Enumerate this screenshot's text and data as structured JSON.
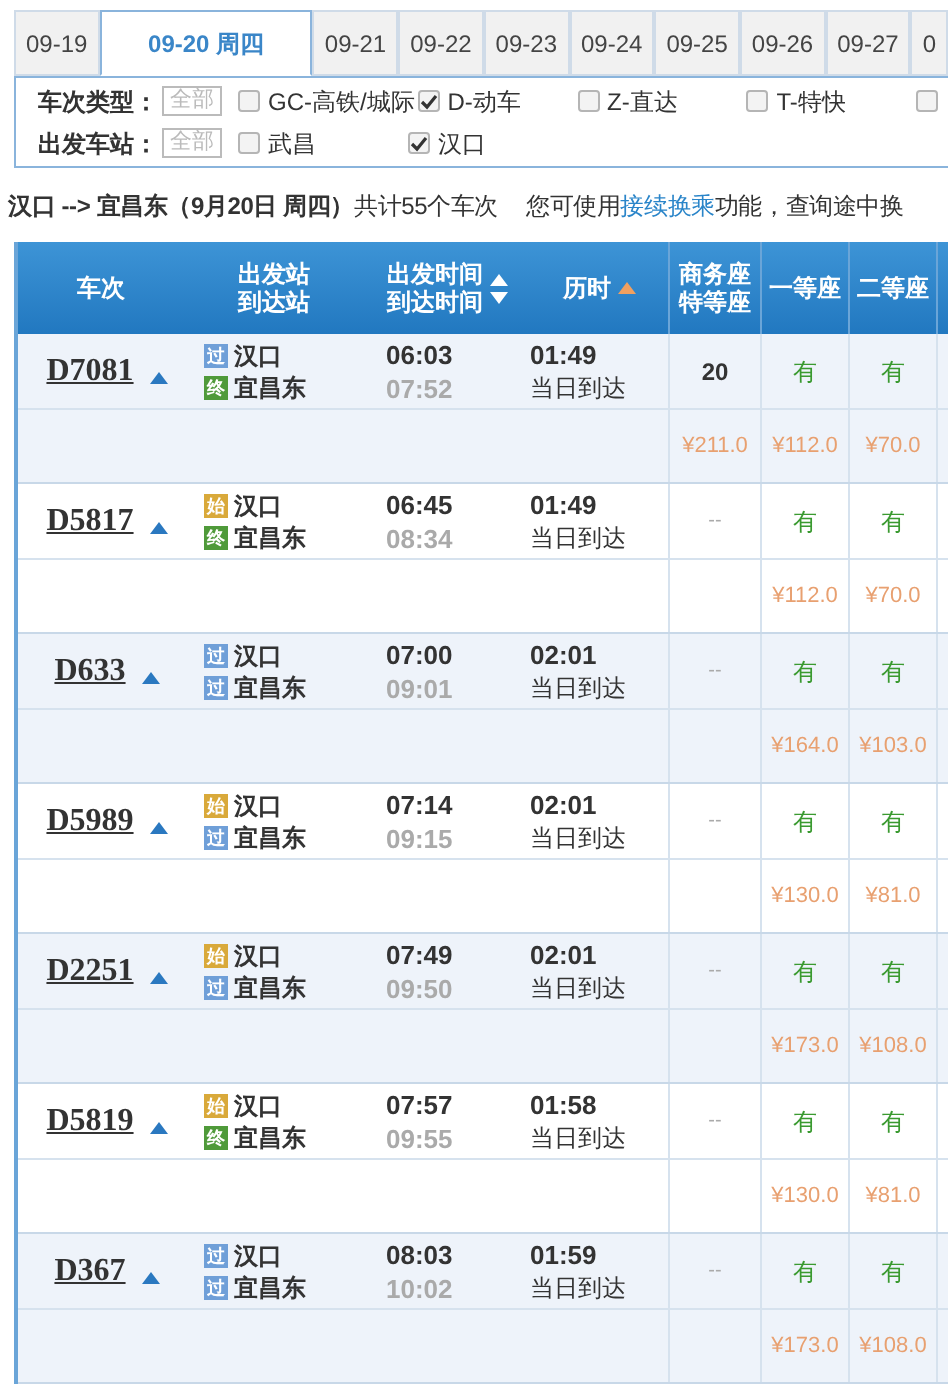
{
  "date_tabs": [
    {
      "label": "09-19",
      "selected": false
    },
    {
      "label": "09-20 周四",
      "selected": true
    },
    {
      "label": "09-21",
      "selected": false
    },
    {
      "label": "09-22",
      "selected": false
    },
    {
      "label": "09-23",
      "selected": false
    },
    {
      "label": "09-24",
      "selected": false
    },
    {
      "label": "09-25",
      "selected": false
    },
    {
      "label": "09-26",
      "selected": false
    },
    {
      "label": "09-27",
      "selected": false
    },
    {
      "label": "0",
      "selected": false
    }
  ],
  "filters": [
    {
      "label": "车次类型：",
      "all_button": "全部",
      "options": [
        {
          "label": "GC-高铁/城际",
          "checked": false
        },
        {
          "label": "D-动车",
          "checked": true
        },
        {
          "label": "Z-直达",
          "checked": false
        },
        {
          "label": "T-特快",
          "checked": false
        },
        {
          "checked": false
        }
      ]
    },
    {
      "label": "出发车站：",
      "all_button": "全部",
      "options": [
        {
          "label": "武昌",
          "checked": false
        },
        {
          "label": "汉口",
          "checked": true
        }
      ]
    }
  ],
  "summary": {
    "route": "汉口 --> 宜昌东（9月20日  周四）",
    "count": "共计55个车次",
    "hint_before": "您可使用",
    "hint_link": "接续换乘",
    "hint_after": "功能，查询途中换"
  },
  "table": {
    "columns": [
      {
        "lines": [
          "车次"
        ]
      },
      {
        "lines": [
          "出发站",
          "到达站"
        ]
      },
      {
        "lines": [
          "出发时间",
          "到达时间"
        ],
        "sort_up": true,
        "sort_down": true
      },
      {
        "lines": [
          "历时"
        ],
        "sort_up": true,
        "sort_down": false
      },
      {
        "lines": [
          "商务座",
          "特等座"
        ]
      },
      {
        "lines": [
          "一等座"
        ]
      },
      {
        "lines": [
          "二等座"
        ]
      }
    ],
    "trains": [
      {
        "number": "D7081",
        "from_badge": {
          "kind": "pass",
          "text": "过"
        },
        "from": "汉口",
        "to_badge": {
          "kind": "end",
          "text": "终"
        },
        "to": "宜昌东",
        "depart": "06:03",
        "arrive": "07:52",
        "duration": "01:49",
        "arrival_day": "当日到达",
        "business": "20",
        "first": "有",
        "second": "有",
        "business_price": "¥211.0",
        "first_price": "¥112.0",
        "second_price": "¥70.0"
      },
      {
        "number": "D5817",
        "from_badge": {
          "kind": "start",
          "text": "始"
        },
        "from": "汉口",
        "to_badge": {
          "kind": "end",
          "text": "终"
        },
        "to": "宜昌东",
        "depart": "06:45",
        "arrive": "08:34",
        "duration": "01:49",
        "arrival_day": "当日到达",
        "business": "--",
        "first": "有",
        "second": "有",
        "first_price": "¥112.0",
        "second_price": "¥70.0"
      },
      {
        "number": "D633",
        "from_badge": {
          "kind": "pass",
          "text": "过"
        },
        "from": "汉口",
        "to_badge": {
          "kind": "pass",
          "text": "过"
        },
        "to": "宜昌东",
        "depart": "07:00",
        "arrive": "09:01",
        "duration": "02:01",
        "arrival_day": "当日到达",
        "business": "--",
        "first": "有",
        "second": "有",
        "first_price": "¥164.0",
        "second_price": "¥103.0"
      },
      {
        "number": "D5989",
        "from_badge": {
          "kind": "start",
          "text": "始"
        },
        "from": "汉口",
        "to_badge": {
          "kind": "pass",
          "text": "过"
        },
        "to": "宜昌东",
        "depart": "07:14",
        "arrive": "09:15",
        "duration": "02:01",
        "arrival_day": "当日到达",
        "business": "--",
        "first": "有",
        "second": "有",
        "first_price": "¥130.0",
        "second_price": "¥81.0"
      },
      {
        "number": "D2251",
        "from_badge": {
          "kind": "start",
          "text": "始"
        },
        "from": "汉口",
        "to_badge": {
          "kind": "pass",
          "text": "过"
        },
        "to": "宜昌东",
        "depart": "07:49",
        "arrive": "09:50",
        "duration": "02:01",
        "arrival_day": "当日到达",
        "business": "--",
        "first": "有",
        "second": "有",
        "first_price": "¥173.0",
        "second_price": "¥108.0"
      },
      {
        "number": "D5819",
        "from_badge": {
          "kind": "start",
          "text": "始"
        },
        "from": "汉口",
        "to_badge": {
          "kind": "end",
          "text": "终"
        },
        "to": "宜昌东",
        "depart": "07:57",
        "arrive": "09:55",
        "duration": "01:58",
        "arrival_day": "当日到达",
        "business": "--",
        "first": "有",
        "second": "有",
        "first_price": "¥130.0",
        "second_price": "¥81.0"
      },
      {
        "number": "D367",
        "from_badge": {
          "kind": "pass",
          "text": "过"
        },
        "from": "汉口",
        "to_badge": {
          "kind": "pass",
          "text": "过"
        },
        "to": "宜昌东",
        "depart": "08:03",
        "arrive": "10:02",
        "duration": "01:59",
        "arrival_day": "当日到达",
        "business": "--",
        "first": "有",
        "second": "有",
        "first_price": "¥173.0",
        "second_price": "¥108.0"
      }
    ]
  }
}
